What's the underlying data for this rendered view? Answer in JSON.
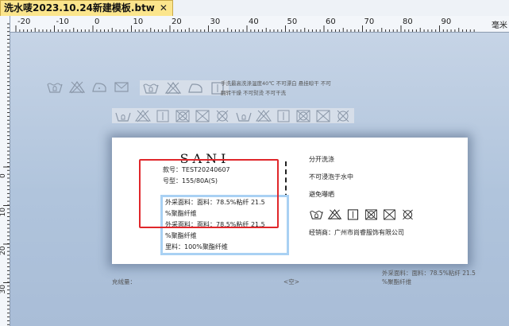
{
  "tab": {
    "title": "洗水唛2023.10.24新建模板.btw",
    "close": "✕"
  },
  "ruler": {
    "unit": "毫米",
    "top_ticks": [
      "-20",
      "-10",
      "0",
      "10",
      "20",
      "30",
      "40",
      "50",
      "60",
      "70",
      "80",
      "90"
    ],
    "left_ticks": [
      "0",
      "10",
      "20",
      "30"
    ]
  },
  "ghost": {
    "line1": "手洗最高洗涤温度40℃ 不可漂白 悬挂晾干 不可",
    "line2": "翻转干燥  不可熨烫 不可干洗",
    "bottom_left": "充绒量：",
    "bottom_mid": "<空>",
    "bottom_right_1": "外采面料：面料：78.5%粘纤 21.5",
    "bottom_right_2": "%聚酯纤维"
  },
  "label": {
    "brand": "SANI",
    "style_no": "款号：TEST20240607",
    "size": "号型：155/80A(S)",
    "fabric_lines": [
      "外采面料：面料：78.5%粘纤 21.5",
      "%聚酯纤维",
      "外采面料：面料：78.5%粘纤 21.5",
      "%聚酯纤维",
      "里料：100%聚酯纤维"
    ],
    "care_1": "分开洗涤",
    "care_2": "不可浸泡于水中",
    "care_3": "避免曝晒",
    "distributor": "经销商：广州市尚睿服饰有限公司"
  },
  "colors": {
    "highlight": "#e0272b",
    "fabric_border": "#a9d1f3",
    "tab": "#fbe58c"
  },
  "icons": [
    "handwash-icon",
    "no-bleach-icon",
    "hang-dry-icon",
    "flat-dry-icon",
    "no-tumble-dry-icon",
    "no-iron-icon",
    "no-dryclean-icon",
    "no-wring-icon"
  ]
}
